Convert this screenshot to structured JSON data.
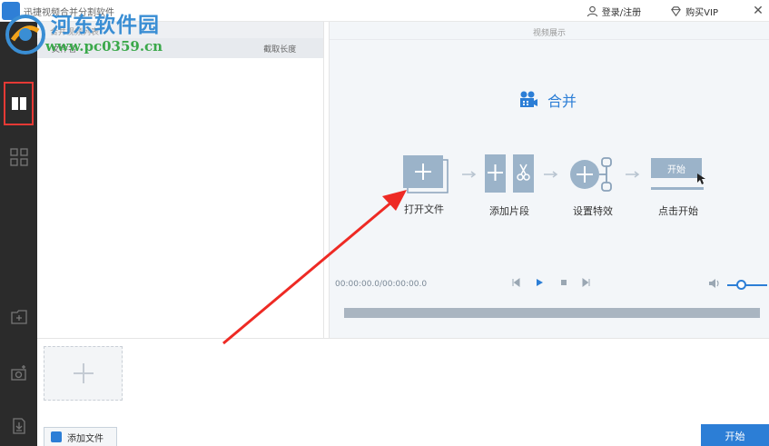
{
  "app": {
    "title": "迅捷视频合并分割软件"
  },
  "watermark": {
    "line1": "河东软件园",
    "line2": "www.pc0359.cn"
  },
  "topbar": {
    "login_label": "登录/注册",
    "vip_label": "购买VIP",
    "close_glyph": "✕"
  },
  "left_panel": {
    "header": "合并视频列表",
    "col_file": "文件名",
    "col_duration": "截取长度"
  },
  "preview": {
    "header": "视频展示",
    "mode_title": "合并",
    "steps": {
      "open": "打开文件",
      "add_clip": "添加片段",
      "effects": "设置特效",
      "start": "点击开始",
      "start_inner": "开始"
    },
    "time": "00:00:00.0/00:00:00.0",
    "volume_level": 0.35
  },
  "bottom": {
    "add_file_label": "添加文件",
    "start_label": "开始"
  },
  "colors": {
    "accent": "#2c7ed6",
    "sidebar_bg": "#2b2b2b",
    "highlight": "#e53935",
    "annotation_arrow": "#ee2a24"
  }
}
